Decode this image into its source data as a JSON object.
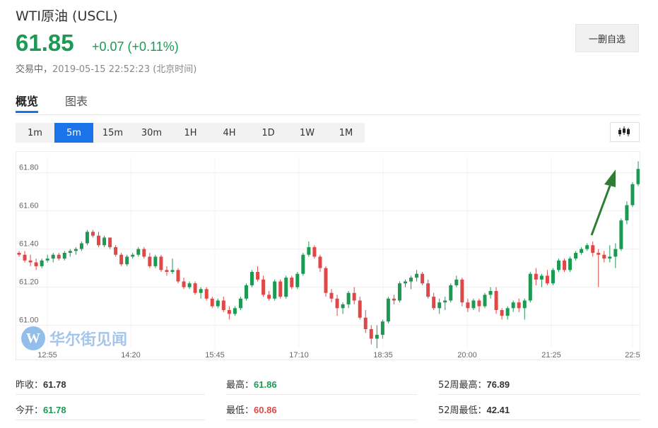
{
  "header": {
    "title": "WTI原油 (USCL)",
    "price": "61.85",
    "change": "+0.07 (+0.11%)",
    "status": "交易中，",
    "timestamp": "2019-05-15 22:52:23 (北京时间)",
    "watch_button": "一删自选"
  },
  "tabs": [
    "概览",
    "图表"
  ],
  "periods": [
    "1m",
    "5m",
    "15m",
    "30m",
    "1H",
    "4H",
    "1D",
    "1W",
    "1M"
  ],
  "active_period": "5m",
  "stats": {
    "prev_close_label": "昨收：",
    "prev_close": "61.78",
    "open_label": "今开：",
    "open": "61.78",
    "high_label": "最高：",
    "high": "61.86",
    "low_label": "最低：",
    "low": "60.86",
    "w52_high_label": "52周最高：",
    "w52_high": "76.89",
    "w52_low_label": "52周最低：",
    "w52_low": "42.41"
  },
  "watermark": {
    "logo_letter": "W",
    "text": "华尔街见闻"
  },
  "colors": {
    "up": "#1c9a53",
    "down": "#e04848",
    "accent": "#1a73e8",
    "arrow": "#2e7d32"
  },
  "chart_data": {
    "type": "candlestick",
    "title": "",
    "x_ticks": [
      "12:55",
      "14:20",
      "15:45",
      "17:10",
      "18:35",
      "20:00",
      "21:25",
      "22:5"
    ],
    "y_ticks": [
      61.0,
      61.2,
      61.4,
      61.6,
      61.8
    ],
    "ylim": [
      60.88,
      61.88
    ],
    "grid": true,
    "annotation": "green arrow pointing up toward the latest candles",
    "candles": [
      [
        61.38,
        61.39,
        61.36,
        61.37
      ],
      [
        61.37,
        61.39,
        61.33,
        61.34
      ],
      [
        61.34,
        61.37,
        61.31,
        61.33
      ],
      [
        61.33,
        61.35,
        61.29,
        61.31
      ],
      [
        61.31,
        61.35,
        61.3,
        61.34
      ],
      [
        61.34,
        61.37,
        61.33,
        61.35
      ],
      [
        61.35,
        61.38,
        61.33,
        61.37
      ],
      [
        61.37,
        61.38,
        61.34,
        61.35
      ],
      [
        61.35,
        61.39,
        61.34,
        61.38
      ],
      [
        61.38,
        61.4,
        61.36,
        61.39
      ],
      [
        61.39,
        61.41,
        61.37,
        61.4
      ],
      [
        61.4,
        61.44,
        61.39,
        61.43
      ],
      [
        61.43,
        61.5,
        61.42,
        61.49
      ],
      [
        61.49,
        61.5,
        61.46,
        61.47
      ],
      [
        61.47,
        61.49,
        61.41,
        61.42
      ],
      [
        61.42,
        61.47,
        61.41,
        61.46
      ],
      [
        61.46,
        61.46,
        61.4,
        61.41
      ],
      [
        61.41,
        61.42,
        61.36,
        61.37
      ],
      [
        61.37,
        61.38,
        61.31,
        61.32
      ],
      [
        61.32,
        61.37,
        61.31,
        61.36
      ],
      [
        61.36,
        61.38,
        61.35,
        61.37
      ],
      [
        61.37,
        61.41,
        61.36,
        61.4
      ],
      [
        61.4,
        61.41,
        61.35,
        61.36
      ],
      [
        61.36,
        61.38,
        61.3,
        61.31
      ],
      [
        61.31,
        61.37,
        61.3,
        61.36
      ],
      [
        61.36,
        61.37,
        61.28,
        61.29
      ],
      [
        61.29,
        61.31,
        61.26,
        61.28
      ],
      [
        61.28,
        61.35,
        61.27,
        61.29
      ],
      [
        61.29,
        61.3,
        61.22,
        61.23
      ],
      [
        61.23,
        61.25,
        61.19,
        61.2
      ],
      [
        61.2,
        61.23,
        61.19,
        61.22
      ],
      [
        61.22,
        61.23,
        61.16,
        61.17
      ],
      [
        61.17,
        61.2,
        61.14,
        61.19
      ],
      [
        61.19,
        61.2,
        61.13,
        61.14
      ],
      [
        61.14,
        61.15,
        61.09,
        61.1
      ],
      [
        61.1,
        61.14,
        61.09,
        61.13
      ],
      [
        61.13,
        61.15,
        61.07,
        61.08
      ],
      [
        61.08,
        61.1,
        61.03,
        61.06
      ],
      [
        61.06,
        61.1,
        61.05,
        61.09
      ],
      [
        61.09,
        61.15,
        61.08,
        61.14
      ],
      [
        61.14,
        61.22,
        61.13,
        61.21
      ],
      [
        61.21,
        61.29,
        61.2,
        61.28
      ],
      [
        61.28,
        61.31,
        61.23,
        61.24
      ],
      [
        61.24,
        61.26,
        61.15,
        61.16
      ],
      [
        61.16,
        61.18,
        61.13,
        61.14
      ],
      [
        61.14,
        61.24,
        61.13,
        61.23
      ],
      [
        61.23,
        61.24,
        61.14,
        61.15
      ],
      [
        61.15,
        61.26,
        61.14,
        61.25
      ],
      [
        61.25,
        61.26,
        61.19,
        61.2
      ],
      [
        61.2,
        61.28,
        61.19,
        61.27
      ],
      [
        61.27,
        61.38,
        61.26,
        61.37
      ],
      [
        61.37,
        61.44,
        61.36,
        61.41
      ],
      [
        61.41,
        61.42,
        61.35,
        61.36
      ],
      [
        61.36,
        61.37,
        61.28,
        61.3
      ],
      [
        61.3,
        61.31,
        61.15,
        61.17
      ],
      [
        61.17,
        61.19,
        61.12,
        61.14
      ],
      [
        61.14,
        61.16,
        61.05,
        61.09
      ],
      [
        61.09,
        61.12,
        61.06,
        61.11
      ],
      [
        61.11,
        61.18,
        61.09,
        61.17
      ],
      [
        61.17,
        61.2,
        61.11,
        61.13
      ],
      [
        61.13,
        61.15,
        61.03,
        61.04
      ],
      [
        61.04,
        61.08,
        60.96,
        60.98
      ],
      [
        60.98,
        61.0,
        60.9,
        60.93
      ],
      [
        60.93,
        61.0,
        60.88,
        60.95
      ],
      [
        60.95,
        61.03,
        60.93,
        61.02
      ],
      [
        61.02,
        61.15,
        61.01,
        61.14
      ],
      [
        61.14,
        61.16,
        61.11,
        61.13
      ],
      [
        61.13,
        61.23,
        61.12,
        61.22
      ],
      [
        61.22,
        61.24,
        61.2,
        61.23
      ],
      [
        61.23,
        61.26,
        61.19,
        61.25
      ],
      [
        61.25,
        61.29,
        61.23,
        61.27
      ],
      [
        61.27,
        61.28,
        61.21,
        61.22
      ],
      [
        61.22,
        61.24,
        61.14,
        61.15
      ],
      [
        61.15,
        61.17,
        61.08,
        61.09
      ],
      [
        61.09,
        61.14,
        61.06,
        61.12
      ],
      [
        61.12,
        61.15,
        61.08,
        61.13
      ],
      [
        61.13,
        61.22,
        61.12,
        61.21
      ],
      [
        61.21,
        61.26,
        61.2,
        61.24
      ],
      [
        61.24,
        61.25,
        61.1,
        61.12
      ],
      [
        61.12,
        61.14,
        61.07,
        61.09
      ],
      [
        61.09,
        61.14,
        61.08,
        61.13
      ],
      [
        61.13,
        61.14,
        61.07,
        61.1
      ],
      [
        61.1,
        61.17,
        61.09,
        61.16
      ],
      [
        61.16,
        61.2,
        61.14,
        61.18
      ],
      [
        61.18,
        61.2,
        61.06,
        61.08
      ],
      [
        61.08,
        61.09,
        61.03,
        61.05
      ],
      [
        61.05,
        61.1,
        61.03,
        61.09
      ],
      [
        61.09,
        61.13,
        61.07,
        61.12
      ],
      [
        61.12,
        61.14,
        61.07,
        61.09
      ],
      [
        61.09,
        61.14,
        61.03,
        61.13
      ],
      [
        61.13,
        61.28,
        61.12,
        61.27
      ],
      [
        61.27,
        61.3,
        61.21,
        61.24
      ],
      [
        61.24,
        61.27,
        61.2,
        61.26
      ],
      [
        61.26,
        61.29,
        61.21,
        61.22
      ],
      [
        61.22,
        61.3,
        61.21,
        61.29
      ],
      [
        61.29,
        61.35,
        61.28,
        61.34
      ],
      [
        61.34,
        61.35,
        61.28,
        61.29
      ],
      [
        61.29,
        61.36,
        61.28,
        61.35
      ],
      [
        61.35,
        61.39,
        61.34,
        61.38
      ],
      [
        61.38,
        61.41,
        61.37,
        61.4
      ],
      [
        61.4,
        61.43,
        61.39,
        61.42
      ],
      [
        61.42,
        61.44,
        61.36,
        61.38
      ],
      [
        61.38,
        61.4,
        61.2,
        61.37
      ],
      [
        61.37,
        61.39,
        61.33,
        61.35
      ],
      [
        61.35,
        61.42,
        61.33,
        61.36
      ],
      [
        61.36,
        61.43,
        61.3,
        61.4
      ],
      [
        61.4,
        61.56,
        61.39,
        61.55
      ],
      [
        61.55,
        61.65,
        61.53,
        61.63
      ],
      [
        61.63,
        61.75,
        61.62,
        61.74
      ],
      [
        61.74,
        61.86,
        61.73,
        61.82
      ]
    ]
  }
}
